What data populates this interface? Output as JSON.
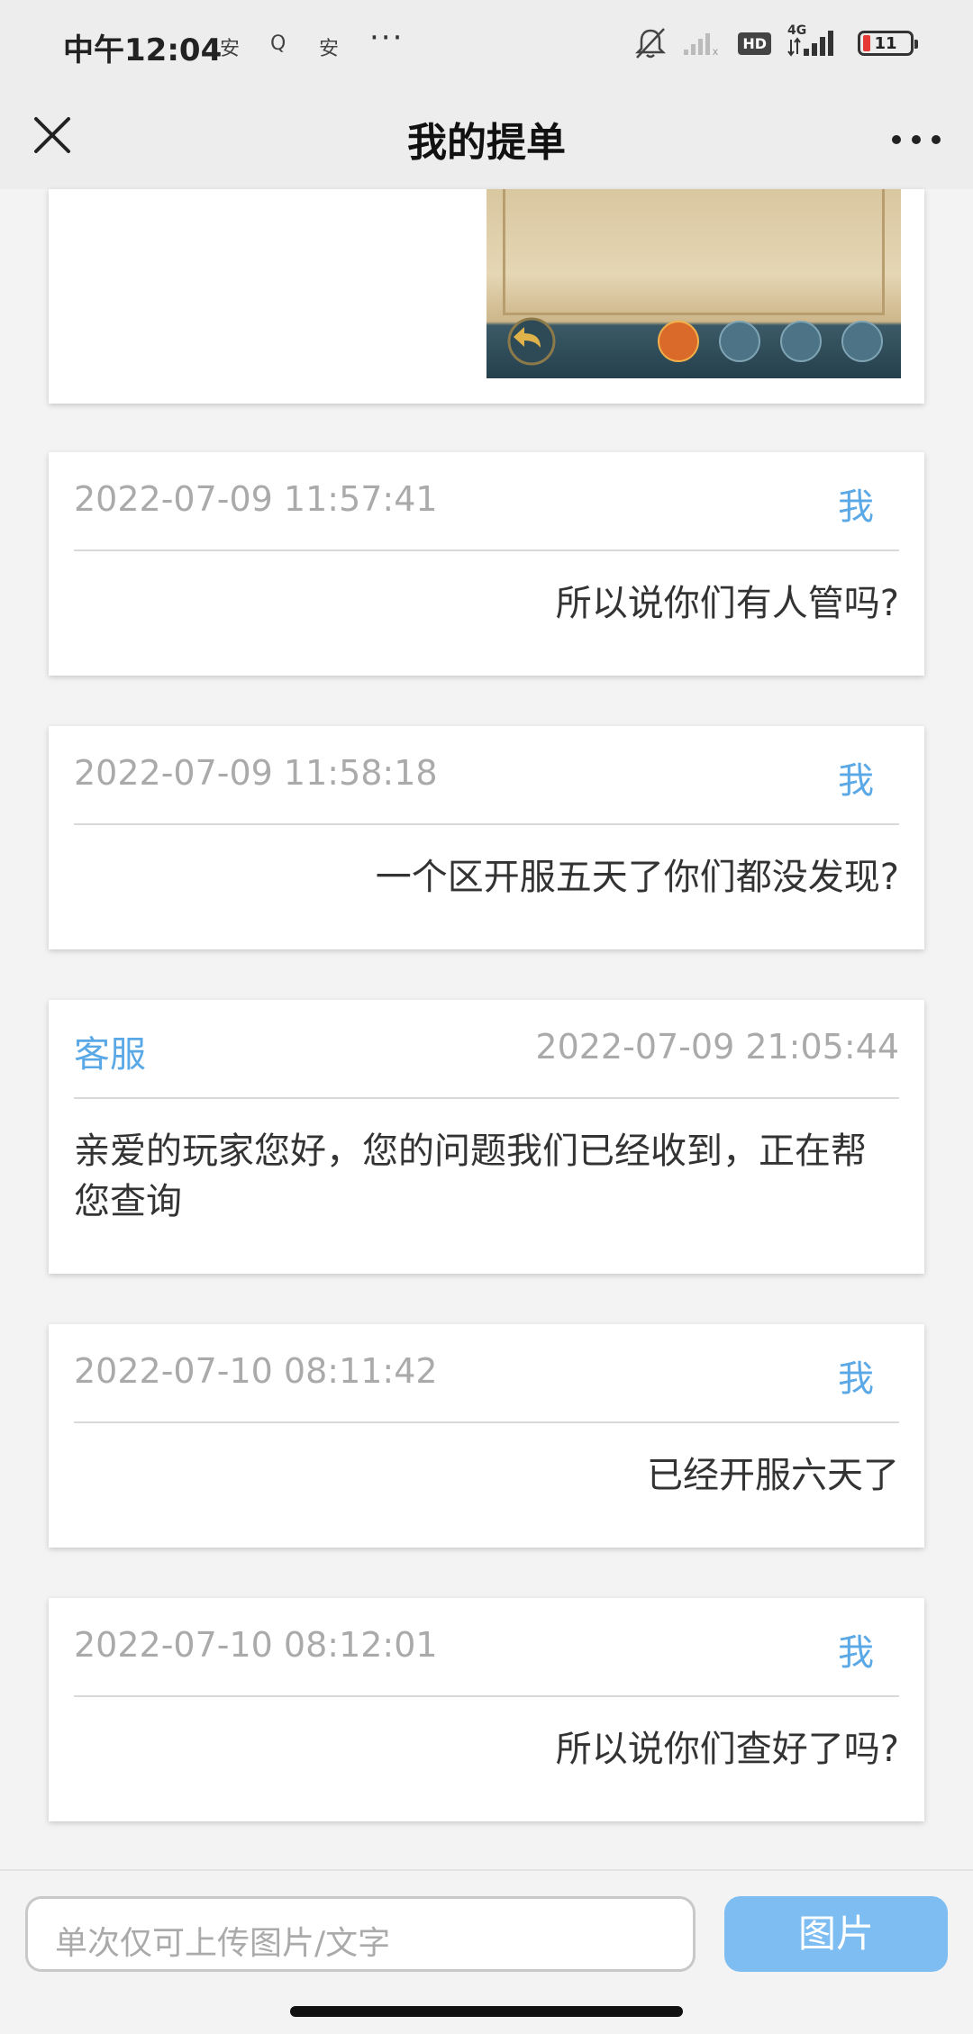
{
  "status_bar": {
    "time": "中午12:04",
    "notif_1": "安",
    "notif_2": "Q",
    "notif_3": "安",
    "more_dots": "···",
    "network_label": "4G",
    "hd_label": "HD",
    "battery_level": "11"
  },
  "navbar": {
    "title": "我的提单"
  },
  "messages": [
    {
      "time": "2022-07-09 11:57:41",
      "sender": "我",
      "text": "所以说你们有人管吗?"
    },
    {
      "time": "2022-07-09 11:58:18",
      "sender": "我",
      "text": "一个区开服五天了你们都没发现?"
    },
    {
      "time": "2022-07-09 21:05:44",
      "sender": "客服",
      "text": "亲爱的玩家您好，您的问题我们已经收到，正在帮您查询"
    },
    {
      "time": "2022-07-10 08:11:42",
      "sender": "我",
      "text": "已经开服六天了"
    },
    {
      "time": "2022-07-10 08:12:01",
      "sender": "我",
      "text": "所以说你们查好了吗?"
    }
  ],
  "input": {
    "placeholder": "单次仅可上传图片/文字",
    "image_button": "图片"
  },
  "colors": {
    "accent": "#5aa9e6",
    "button": "#7dbdf2"
  }
}
